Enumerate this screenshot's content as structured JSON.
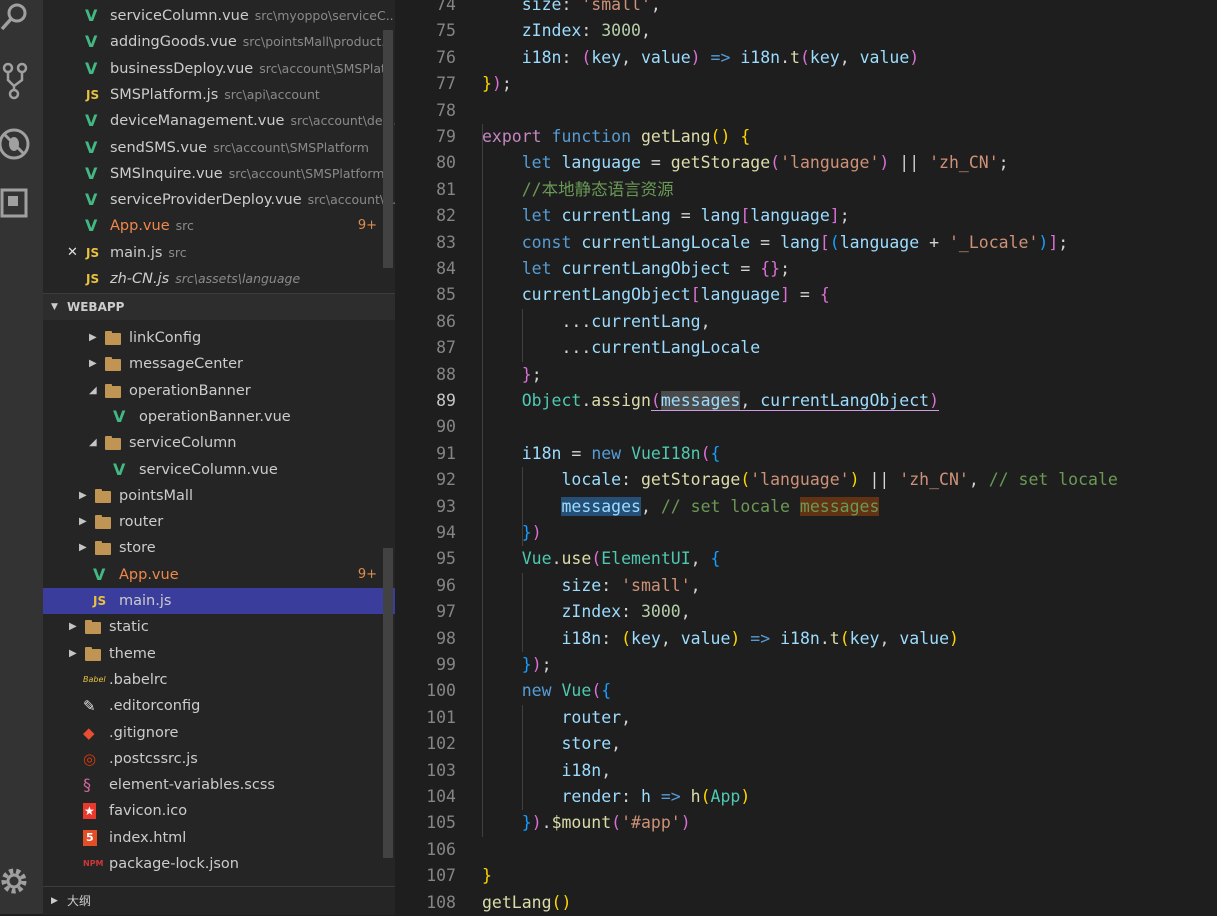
{
  "open_editors": [
    {
      "icon": "vue",
      "name": "serviceColumn.vue",
      "path": "src\\myoppo\\serviceC...",
      "modified": false,
      "badge": ""
    },
    {
      "icon": "vue",
      "name": "addingGoods.vue",
      "path": "src\\pointsMall\\product...",
      "modified": false,
      "badge": ""
    },
    {
      "icon": "vue",
      "name": "businessDeploy.vue",
      "path": "src\\account\\SMSPlat...",
      "modified": false,
      "badge": ""
    },
    {
      "icon": "js",
      "name": "SMSPlatform.js",
      "path": "src\\api\\account",
      "modified": false,
      "badge": ""
    },
    {
      "icon": "vue",
      "name": "deviceManagement.vue",
      "path": "src\\account\\devi...",
      "modified": false,
      "badge": ""
    },
    {
      "icon": "vue",
      "name": "sendSMS.vue",
      "path": "src\\account\\SMSPlatform",
      "modified": false,
      "badge": ""
    },
    {
      "icon": "vue",
      "name": "SMSInquire.vue",
      "path": "src\\account\\SMSPlatform",
      "modified": false,
      "badge": ""
    },
    {
      "icon": "vue",
      "name": "serviceProviderDeploy.vue",
      "path": "src\\account\\...",
      "modified": false,
      "badge": ""
    },
    {
      "icon": "vue",
      "name": "App.vue",
      "path": "src",
      "modified": true,
      "badge": "9+"
    },
    {
      "icon": "js",
      "name": "main.js",
      "path": "src",
      "modified": false,
      "badge": "",
      "close": "✕"
    },
    {
      "icon": "js",
      "name": "zh-CN.js",
      "path": "src\\assets\\language",
      "modified": false,
      "badge": "",
      "italic": true
    }
  ],
  "explorer_section": "WEBAPP",
  "tree": [
    {
      "type": "folder",
      "name": "linkConfig",
      "depth": 2,
      "open": false
    },
    {
      "type": "folder",
      "name": "messageCenter",
      "depth": 2,
      "open": false
    },
    {
      "type": "folder",
      "name": "operationBanner",
      "depth": 2,
      "open": true
    },
    {
      "type": "vue",
      "name": "operationBanner.vue",
      "depth": 3
    },
    {
      "type": "folder",
      "name": "serviceColumn",
      "depth": 2,
      "open": true
    },
    {
      "type": "vue",
      "name": "serviceColumn.vue",
      "depth": 3
    },
    {
      "type": "folder",
      "name": "pointsMall",
      "depth": 1,
      "open": false
    },
    {
      "type": "folder",
      "name": "router",
      "depth": 1,
      "open": false
    },
    {
      "type": "folder",
      "name": "store",
      "depth": 1,
      "open": false
    },
    {
      "type": "vue",
      "name": "App.vue",
      "depth": 1,
      "modified": true,
      "badge": "9+"
    },
    {
      "type": "js",
      "name": "main.js",
      "depth": 1,
      "selected": true
    },
    {
      "type": "folder",
      "name": "static",
      "depth": 0,
      "open": false
    },
    {
      "type": "folder",
      "name": "theme",
      "depth": 0,
      "open": false
    },
    {
      "type": "babel",
      "name": ".babelrc",
      "depth": 0,
      "icon_text": "Babel"
    },
    {
      "type": "editorconfig",
      "name": ".editorconfig",
      "depth": 0
    },
    {
      "type": "git",
      "name": ".gitignore",
      "depth": 0
    },
    {
      "type": "postcss",
      "name": ".postcssrc.js",
      "depth": 0
    },
    {
      "type": "scss",
      "name": "element-variables.scss",
      "depth": 0
    },
    {
      "type": "favicon",
      "name": "favicon.ico",
      "depth": 0
    },
    {
      "type": "html",
      "name": "index.html",
      "depth": 0,
      "icon_text": "5"
    },
    {
      "type": "json",
      "name": "package-lock.json",
      "depth": 0,
      "icon_text": "NPM"
    }
  ],
  "outline_label": "大纲",
  "colors": {
    "selected_row": "#3a3d9b",
    "modified": "#f0884a",
    "vue": "#42b883",
    "js": "#e8c13f"
  },
  "editor": {
    "active_line": "89",
    "lines": [
      {
        "n": "74",
        "tokens": [
          [
            "    ",
            "op"
          ],
          [
            "size",
            "var"
          ],
          [
            ": ",
            "op"
          ],
          [
            "'small'",
            "str"
          ],
          [
            ",",
            "op"
          ]
        ]
      },
      {
        "n": "75",
        "tokens": [
          [
            "    ",
            "op"
          ],
          [
            "zIndex",
            "var"
          ],
          [
            ": ",
            "op"
          ],
          [
            "3000",
            "num"
          ],
          [
            ",",
            "op"
          ]
        ]
      },
      {
        "n": "76",
        "tokens": [
          [
            "    ",
            "op"
          ],
          [
            "i18n",
            "var"
          ],
          [
            ": ",
            "op"
          ],
          [
            "(",
            "p2"
          ],
          [
            "key",
            "var"
          ],
          [
            ", ",
            "op"
          ],
          [
            "value",
            "var"
          ],
          [
            ") ",
            "p2"
          ],
          [
            "=>",
            "kw"
          ],
          [
            " ",
            "op"
          ],
          [
            "i18n",
            "var"
          ],
          [
            ".",
            "op"
          ],
          [
            "t",
            "fn"
          ],
          [
            "(",
            "p2"
          ],
          [
            "key",
            "var"
          ],
          [
            ", ",
            "op"
          ],
          [
            "value",
            "var"
          ],
          [
            ")",
            "p2"
          ]
        ]
      },
      {
        "n": "77",
        "tokens": [
          [
            "}",
            "p1"
          ],
          [
            ")",
            "p2"
          ],
          [
            ";",
            "op"
          ]
        ]
      },
      {
        "n": "78",
        "tokens": []
      },
      {
        "n": "79",
        "tokens": [
          [
            "export",
            "kwp"
          ],
          [
            " ",
            "op"
          ],
          [
            "function",
            "kw"
          ],
          [
            " ",
            "op"
          ],
          [
            "getLang",
            "fn"
          ],
          [
            "() ",
            "p1"
          ],
          [
            "{",
            "p1"
          ]
        ]
      },
      {
        "n": "80",
        "tokens": [
          [
            "    ",
            "op"
          ],
          [
            "let",
            "kw"
          ],
          [
            " ",
            "op"
          ],
          [
            "language",
            "var"
          ],
          [
            " = ",
            "op"
          ],
          [
            "getStorage",
            "fn"
          ],
          [
            "(",
            "p2"
          ],
          [
            "'language'",
            "str"
          ],
          [
            ")",
            "p2"
          ],
          [
            " || ",
            "op"
          ],
          [
            "'zh_CN'",
            "str"
          ],
          [
            ";",
            "op"
          ]
        ]
      },
      {
        "n": "81",
        "tokens": [
          [
            "    ",
            "op"
          ],
          [
            "//本地静态语言资源",
            "cm"
          ]
        ]
      },
      {
        "n": "82",
        "tokens": [
          [
            "    ",
            "op"
          ],
          [
            "let",
            "kw"
          ],
          [
            " ",
            "op"
          ],
          [
            "currentLang",
            "var"
          ],
          [
            " = ",
            "op"
          ],
          [
            "lang",
            "var"
          ],
          [
            "[",
            "p2"
          ],
          [
            "language",
            "var"
          ],
          [
            "]",
            "p2"
          ],
          [
            ";",
            "op"
          ]
        ]
      },
      {
        "n": "83",
        "tokens": [
          [
            "    ",
            "op"
          ],
          [
            "const",
            "kw"
          ],
          [
            " ",
            "op"
          ],
          [
            "currentLangLocale",
            "var"
          ],
          [
            " = ",
            "op"
          ],
          [
            "lang",
            "var"
          ],
          [
            "[",
            "p2"
          ],
          [
            "(",
            "p3"
          ],
          [
            "language",
            "var"
          ],
          [
            " + ",
            "op"
          ],
          [
            "'_Locale'",
            "str"
          ],
          [
            ")",
            "p3"
          ],
          [
            "]",
            "p2"
          ],
          [
            ";",
            "op"
          ]
        ]
      },
      {
        "n": "84",
        "tokens": [
          [
            "    ",
            "op"
          ],
          [
            "let",
            "kw"
          ],
          [
            " ",
            "op"
          ],
          [
            "currentLangObject",
            "var"
          ],
          [
            " = ",
            "op"
          ],
          [
            "{}",
            "p2"
          ],
          [
            ";",
            "op"
          ]
        ]
      },
      {
        "n": "85",
        "tokens": [
          [
            "    ",
            "op"
          ],
          [
            "currentLangObject",
            "var"
          ],
          [
            "[",
            "p2"
          ],
          [
            "language",
            "var"
          ],
          [
            "]",
            "p2"
          ],
          [
            " = ",
            "op"
          ],
          [
            "{",
            "p2"
          ]
        ]
      },
      {
        "n": "86",
        "tokens": [
          [
            "        ",
            "op"
          ],
          [
            "...",
            "op"
          ],
          [
            "currentLang",
            "var"
          ],
          [
            ",",
            "op"
          ]
        ]
      },
      {
        "n": "87",
        "tokens": [
          [
            "        ",
            "op"
          ],
          [
            "...",
            "op"
          ],
          [
            "currentLangLocale",
            "var"
          ]
        ]
      },
      {
        "n": "88",
        "tokens": [
          [
            "    ",
            "op"
          ],
          [
            "}",
            "p2"
          ],
          [
            ";",
            "op"
          ]
        ]
      },
      {
        "n": "89",
        "tokens": [
          [
            "    ",
            "op"
          ],
          [
            "Object",
            "cls"
          ],
          [
            ".",
            "op"
          ],
          [
            "assign",
            "fn"
          ],
          [
            "(",
            "p2 underline"
          ],
          [
            "messages",
            "var hl-grey underline"
          ],
          [
            ", ",
            "op underline"
          ],
          [
            "currentLangObject",
            "var underline"
          ],
          [
            ")",
            "p2 underline"
          ]
        ]
      },
      {
        "n": "90",
        "tokens": []
      },
      {
        "n": "91",
        "tokens": [
          [
            "    ",
            "op"
          ],
          [
            "i18n",
            "var"
          ],
          [
            " = ",
            "op"
          ],
          [
            "new",
            "kw"
          ],
          [
            " ",
            "op"
          ],
          [
            "VueI18n",
            "cls"
          ],
          [
            "(",
            "p2"
          ],
          [
            "{",
            "p3"
          ]
        ]
      },
      {
        "n": "92",
        "tokens": [
          [
            "        ",
            "op"
          ],
          [
            "locale",
            "var"
          ],
          [
            ": ",
            "op"
          ],
          [
            "getStorage",
            "fn"
          ],
          [
            "(",
            "p1"
          ],
          [
            "'language'",
            "str"
          ],
          [
            ")",
            "p1"
          ],
          [
            " || ",
            "op"
          ],
          [
            "'zh_CN'",
            "str"
          ],
          [
            ", ",
            "op"
          ],
          [
            "// set locale",
            "cm"
          ]
        ]
      },
      {
        "n": "93",
        "tokens": [
          [
            "        ",
            "op"
          ],
          [
            "messages",
            "var hl-blue"
          ],
          [
            ", ",
            "op"
          ],
          [
            "// set locale ",
            "cm"
          ],
          [
            "messages",
            "cm hl-brown"
          ]
        ]
      },
      {
        "n": "94",
        "tokens": [
          [
            "    ",
            "op"
          ],
          [
            "}",
            "p3"
          ],
          [
            ")",
            "p2"
          ]
        ]
      },
      {
        "n": "95",
        "tokens": [
          [
            "    ",
            "op"
          ],
          [
            "Vue",
            "cls"
          ],
          [
            ".",
            "op"
          ],
          [
            "use",
            "fn"
          ],
          [
            "(",
            "p2"
          ],
          [
            "ElementUI",
            "cls"
          ],
          [
            ", ",
            "op"
          ],
          [
            "{",
            "p3"
          ]
        ]
      },
      {
        "n": "96",
        "tokens": [
          [
            "        ",
            "op"
          ],
          [
            "size",
            "var"
          ],
          [
            ": ",
            "op"
          ],
          [
            "'small'",
            "str"
          ],
          [
            ",",
            "op"
          ]
        ]
      },
      {
        "n": "97",
        "tokens": [
          [
            "        ",
            "op"
          ],
          [
            "zIndex",
            "var"
          ],
          [
            ": ",
            "op"
          ],
          [
            "3000",
            "num"
          ],
          [
            ",",
            "op"
          ]
        ]
      },
      {
        "n": "98",
        "tokens": [
          [
            "        ",
            "op"
          ],
          [
            "i18n",
            "var"
          ],
          [
            ": ",
            "op"
          ],
          [
            "(",
            "p1"
          ],
          [
            "key",
            "var"
          ],
          [
            ", ",
            "op"
          ],
          [
            "value",
            "var"
          ],
          [
            ") ",
            "p1"
          ],
          [
            "=>",
            "kw"
          ],
          [
            " ",
            "op"
          ],
          [
            "i18n",
            "var"
          ],
          [
            ".",
            "op"
          ],
          [
            "t",
            "fn"
          ],
          [
            "(",
            "p1"
          ],
          [
            "key",
            "var"
          ],
          [
            ", ",
            "op"
          ],
          [
            "value",
            "var"
          ],
          [
            ")",
            "p1"
          ]
        ]
      },
      {
        "n": "99",
        "tokens": [
          [
            "    ",
            "op"
          ],
          [
            "}",
            "p3"
          ],
          [
            ")",
            "p2"
          ],
          [
            ";",
            "op"
          ]
        ]
      },
      {
        "n": "100",
        "tokens": [
          [
            "    ",
            "op"
          ],
          [
            "new",
            "kw"
          ],
          [
            " ",
            "op"
          ],
          [
            "Vue",
            "cls"
          ],
          [
            "(",
            "p2"
          ],
          [
            "{",
            "p3"
          ]
        ]
      },
      {
        "n": "101",
        "tokens": [
          [
            "        ",
            "op"
          ],
          [
            "router",
            "var"
          ],
          [
            ",",
            "op"
          ]
        ]
      },
      {
        "n": "102",
        "tokens": [
          [
            "        ",
            "op"
          ],
          [
            "store",
            "var"
          ],
          [
            ",",
            "op"
          ]
        ]
      },
      {
        "n": "103",
        "tokens": [
          [
            "        ",
            "op"
          ],
          [
            "i18n",
            "var"
          ],
          [
            ",",
            "op"
          ]
        ]
      },
      {
        "n": "104",
        "tokens": [
          [
            "        ",
            "op"
          ],
          [
            "render",
            "var"
          ],
          [
            ": ",
            "op"
          ],
          [
            "h",
            "var"
          ],
          [
            " => ",
            "kw"
          ],
          [
            "h",
            "fn"
          ],
          [
            "(",
            "p1"
          ],
          [
            "App",
            "cls"
          ],
          [
            ")",
            "p1"
          ]
        ]
      },
      {
        "n": "105",
        "tokens": [
          [
            "    ",
            "op"
          ],
          [
            "}",
            "p3"
          ],
          [
            ")",
            "p2"
          ],
          [
            ".",
            "op"
          ],
          [
            "$mount",
            "fn"
          ],
          [
            "(",
            "p2"
          ],
          [
            "'#app'",
            "str"
          ],
          [
            ")",
            "p2"
          ]
        ]
      },
      {
        "n": "106",
        "tokens": []
      },
      {
        "n": "107",
        "tokens": [
          [
            "}",
            "p1"
          ]
        ]
      },
      {
        "n": "108",
        "tokens": [
          [
            "getLang",
            "fn"
          ],
          [
            "()",
            "p1"
          ]
        ]
      }
    ]
  }
}
